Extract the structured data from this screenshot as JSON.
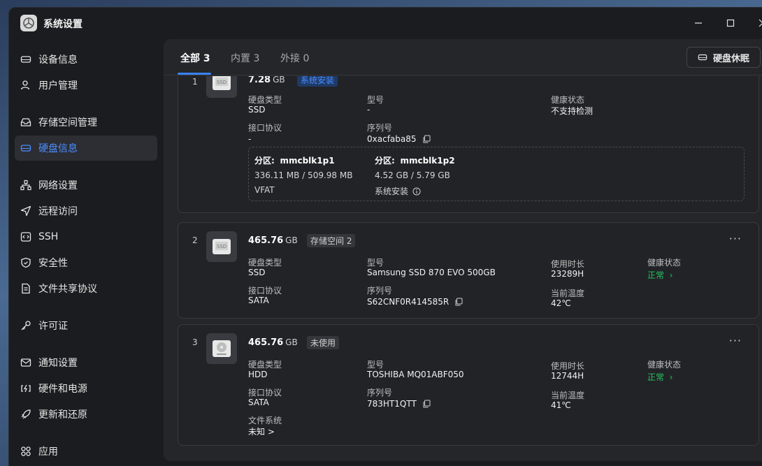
{
  "window": {
    "title": "系统设置",
    "controls": [
      "minimize-icon",
      "maximize-icon",
      "close-icon"
    ]
  },
  "sidebar": {
    "items": [
      {
        "label": "设备信息",
        "icon": "hdd-icon"
      },
      {
        "label": "用户管理",
        "icon": "user-icon"
      },
      {
        "label": "存储空间管理",
        "icon": "inbox-icon"
      },
      {
        "label": "硬盘信息",
        "icon": "disk-icon",
        "active": true
      },
      {
        "label": "网络设置",
        "icon": "network-icon"
      },
      {
        "label": "远程访问",
        "icon": "send-icon"
      },
      {
        "label": "SSH",
        "icon": "code-icon"
      },
      {
        "label": "安全性",
        "icon": "shield-icon"
      },
      {
        "label": "文件共享协议",
        "icon": "file-icon"
      },
      {
        "label": "许可证",
        "icon": "key-icon"
      },
      {
        "label": "通知设置",
        "icon": "mail-icon"
      },
      {
        "label": "硬件和电源",
        "icon": "power-icon"
      },
      {
        "label": "更新和还原",
        "icon": "rocket-icon"
      },
      {
        "label": "应用",
        "icon": "apps-icon"
      }
    ]
  },
  "main": {
    "tabs": [
      {
        "label": "全部 3",
        "active": true
      },
      {
        "label": "内置 3"
      },
      {
        "label": "外接 0"
      }
    ],
    "sleep_button": "硬盘休眠",
    "disks": [
      {
        "index": "1",
        "capacity": "7.28",
        "unit": "GB",
        "tag": "系统安装",
        "type_label": "硬盘类型",
        "type": "SSD",
        "model_label": "型号",
        "model": "-",
        "health_label": "健康状态",
        "health": "不支持检测",
        "iface_label": "接口协议",
        "iface": "-",
        "serial_label": "序列号",
        "serial": "0xacfaba85",
        "partitions": [
          {
            "name_label": "分区:",
            "name": "mmcblk1p1",
            "usage": "336.11 MB / 509.98 MB",
            "fs": "VFAT"
          },
          {
            "name_label": "分区:",
            "name": "mmcblk1p2",
            "usage": "4.52 GB / 5.79 GB",
            "fs": "系统安装"
          }
        ]
      },
      {
        "index": "2",
        "capacity": "465.76",
        "unit": "GB",
        "tag": "存储空间 2",
        "type_label": "硬盘类型",
        "type": "SSD",
        "model_label": "型号",
        "model": "Samsung SSD 870 EVO 500GB",
        "uptime_label": "使用时长",
        "uptime": "23289H",
        "health_label": "健康状态",
        "health": "正常",
        "iface_label": "接口协议",
        "iface": "SATA",
        "serial_label": "序列号",
        "serial": "S62CNF0R414585R",
        "temp_label": "当前温度",
        "temp": "42℃"
      },
      {
        "index": "3",
        "capacity": "465.76",
        "unit": "GB",
        "tag": "未使用",
        "type_label": "硬盘类型",
        "type": "HDD",
        "model_label": "型号",
        "model": "TOSHIBA MQ01ABF050",
        "uptime_label": "使用时长",
        "uptime": "12744H",
        "health_label": "健康状态",
        "health": "正常",
        "iface_label": "接口协议",
        "iface": "SATA",
        "serial_label": "序列号",
        "serial": "783HT1QTT",
        "temp_label": "当前温度",
        "temp": "41℃",
        "fs_label": "文件系统",
        "fs": "未知 >"
      }
    ]
  },
  "colors": {
    "accent": "#3b82f6",
    "active_text": "#4c8dff",
    "healthy": "#22c55e"
  }
}
